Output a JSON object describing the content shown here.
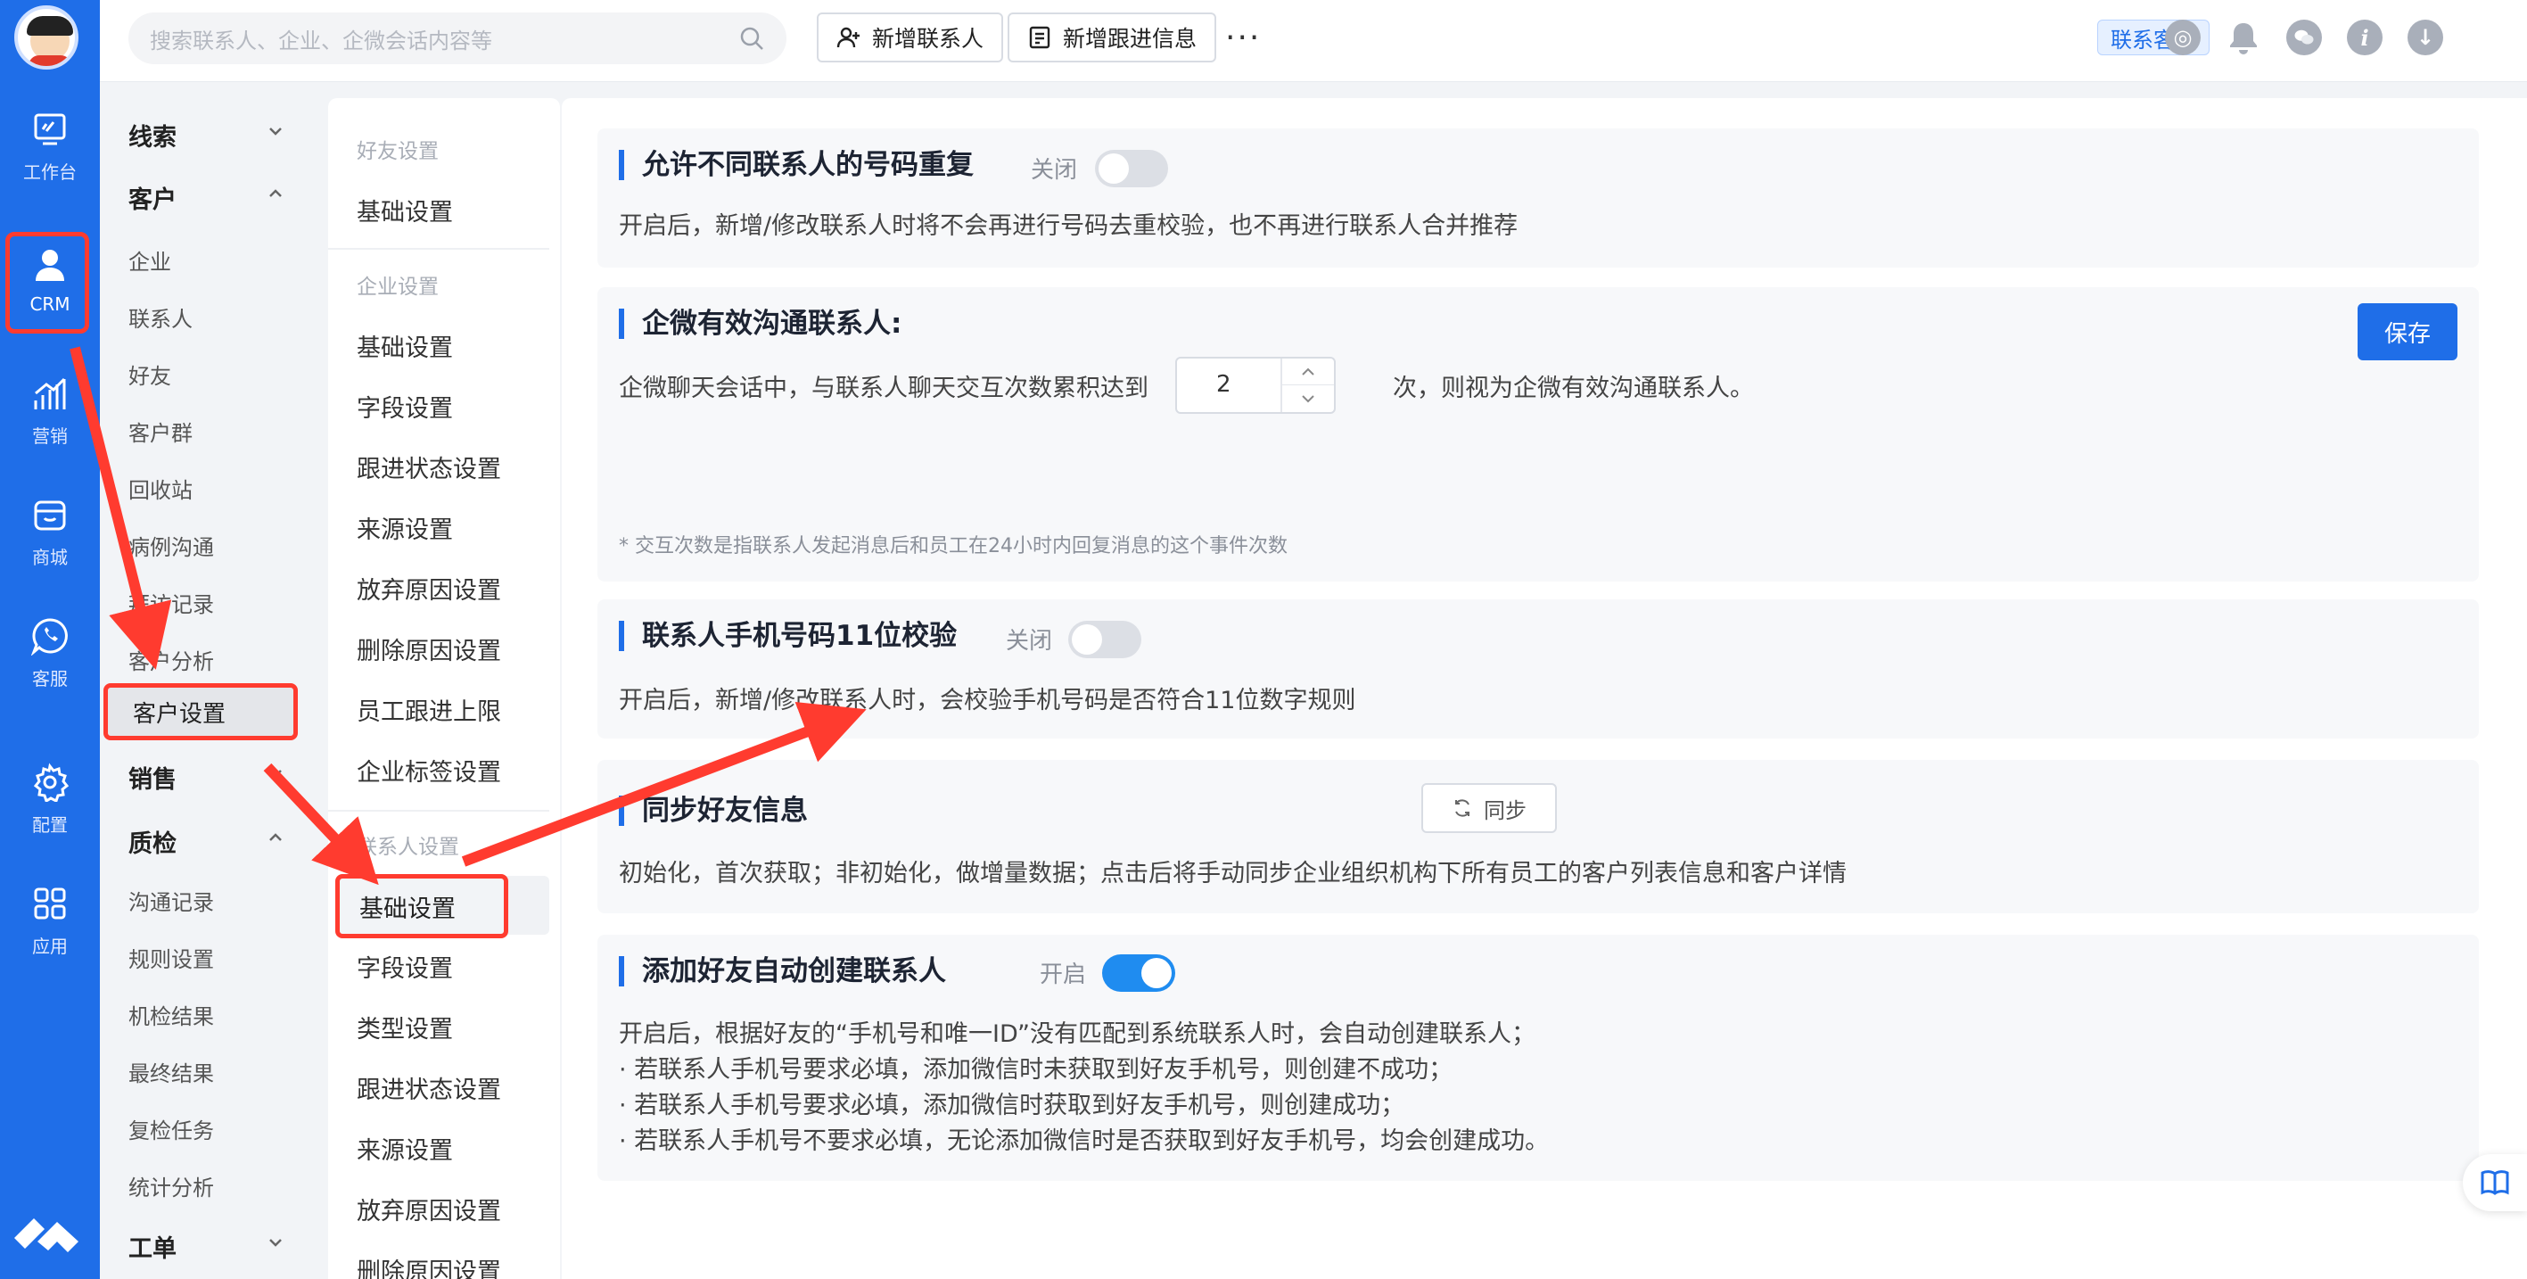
{
  "rail": {
    "items": [
      {
        "label": "工作台",
        "icon": "workbench-icon"
      },
      {
        "label": "CRM",
        "icon": "user-icon"
      },
      {
        "label": "营销",
        "icon": "chart-bars-icon"
      },
      {
        "label": "商城",
        "icon": "store-icon"
      },
      {
        "label": "客服",
        "icon": "chat-phone-icon"
      },
      {
        "label": "配置",
        "icon": "gear-icon"
      },
      {
        "label": "应用",
        "icon": "apps-grid-icon"
      }
    ]
  },
  "topbar": {
    "search_placeholder": "搜索联系人、企业、企微会话内容等",
    "new_contact": "新增联系人",
    "new_followup": "新增跟进信息",
    "more": "···",
    "service": "联系客服"
  },
  "nav1": {
    "group_leads": "线索",
    "group_customer": "客户",
    "customer_items": [
      "企业",
      "联系人",
      "好友",
      "客户群",
      "回收站",
      "病例沟通",
      "拜访记录",
      "客户分析",
      "客户设置"
    ],
    "group_sales": "销售",
    "group_qc": "质检",
    "qc_items": [
      "沟通记录",
      "规则设置",
      "机检结果",
      "最终结果",
      "复检任务",
      "统计分析"
    ],
    "group_ticket": "工单"
  },
  "nav2": {
    "sec_friend": "好友设置",
    "friend_items": [
      "基础设置"
    ],
    "sec_company": "企业设置",
    "company_items": [
      "基础设置",
      "字段设置",
      "跟进状态设置",
      "来源设置",
      "放弃原因设置",
      "删除原因设置",
      "员工跟进上限",
      "企业标签设置"
    ],
    "sec_contact": "联系人设置",
    "contact_items": [
      "基础设置",
      "字段设置",
      "类型设置",
      "跟进状态设置",
      "来源设置",
      "放弃原因设置",
      "删除原因设置"
    ]
  },
  "main": {
    "dup": {
      "title": "允许不同联系人的号码重复",
      "toggle_label": "关闭",
      "toggle_on": false,
      "desc": "开启后，新增/修改联系人时将不会再进行号码去重校验，也不再进行联系人合并推荐"
    },
    "wecom": {
      "title": "企微有效沟通联系人:",
      "save": "保存",
      "desc_pre": "企微聊天会话中，与联系人聊天交互次数累积达到",
      "count": "2",
      "desc_post": "次，则视为企微有效沟通联系人。",
      "note": "* 交互次数是指联系人发起消息后和员工在24小时内回复消息的这个事件次数"
    },
    "phone": {
      "title": "联系人手机号码11位校验",
      "toggle_label": "关闭",
      "toggle_on": false,
      "desc": "开启后，新增/修改联系人时，会校验手机号码是否符合11位数字规则"
    },
    "sync": {
      "title": "同步好友信息",
      "button": "同步",
      "desc": "初始化，首次获取；非初始化，做增量数据；点击后将手动同步企业组织机构下所有员工的客户列表信息和客户详情"
    },
    "auto": {
      "title": "添加好友自动创建联系人",
      "toggle_label": "开启",
      "toggle_on": true,
      "lines": [
        "开启后，根据好友的“手机号和唯一ID”没有匹配到系统联系人时，会自动创建联系人；",
        "· 若联系人手机号要求必填，添加微信时未获取到好友手机号，则创建不成功；",
        "· 若联系人手机号要求必填，添加微信时获取到好友手机号，则创建成功；",
        "· 若联系人手机号不要求必填，无论添加微信时是否获取到好友手机号，均会创建成功。"
      ]
    }
  },
  "colors": {
    "brand": "#1f6ee8",
    "highlight": "#ff3b2f",
    "toggle_on": "#1f8cf0"
  }
}
